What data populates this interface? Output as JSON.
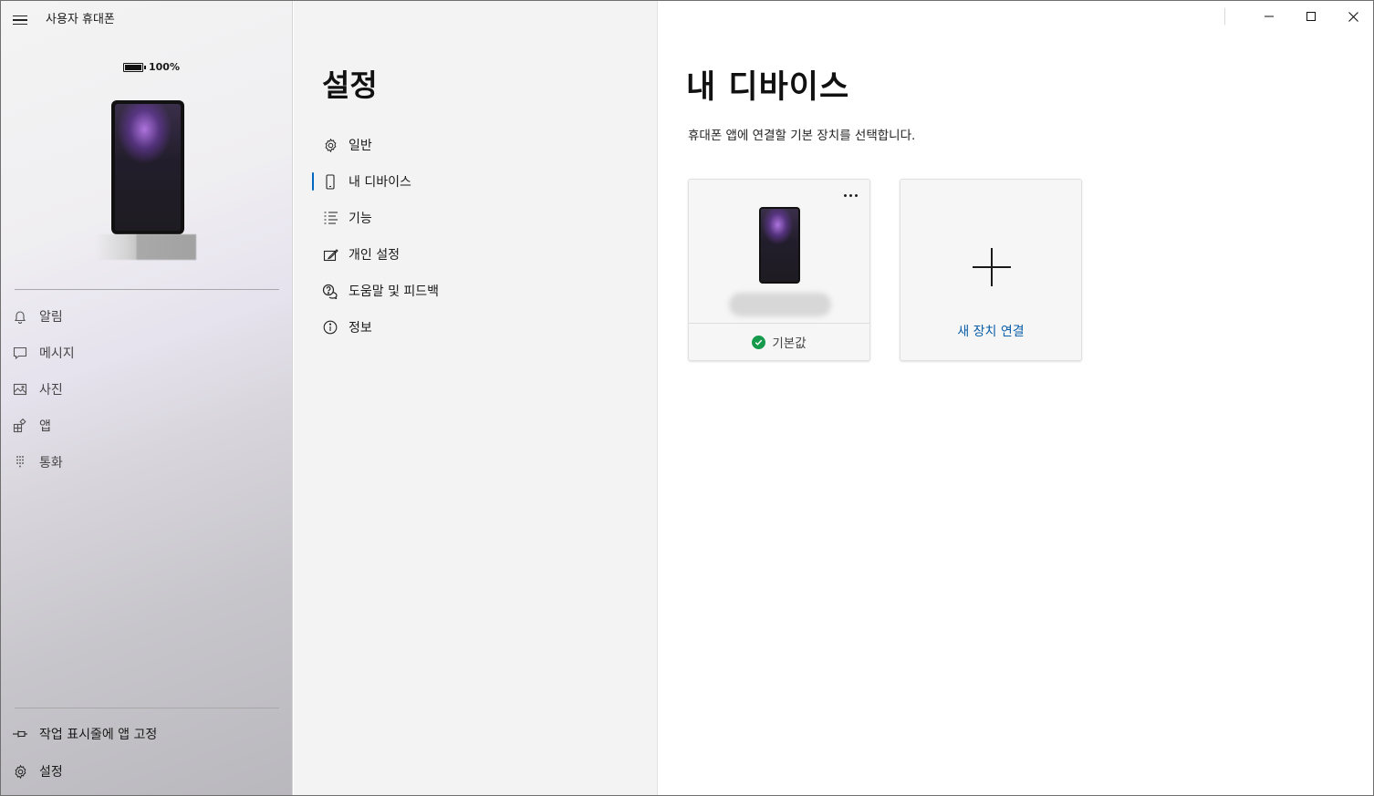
{
  "app": {
    "title": "사용자 휴대폰"
  },
  "phone": {
    "battery": "100%"
  },
  "sidebar": {
    "items": [
      {
        "label": "알림",
        "icon": "bell-icon"
      },
      {
        "label": "메시지",
        "icon": "message-icon"
      },
      {
        "label": "사진",
        "icon": "photo-icon"
      },
      {
        "label": "앱",
        "icon": "apps-icon"
      },
      {
        "label": "통화",
        "icon": "dialpad-icon"
      }
    ],
    "pin_label": "작업 표시줄에 앱 고정",
    "settings_label": "설정"
  },
  "settings": {
    "title": "설정",
    "items": [
      {
        "label": "일반",
        "icon": "gear-icon"
      },
      {
        "label": "내 디바이스",
        "icon": "phone-icon",
        "selected": true
      },
      {
        "label": "기능",
        "icon": "features-list-icon"
      },
      {
        "label": "개인 설정",
        "icon": "personalize-icon"
      },
      {
        "label": "도움말 및 피드백",
        "icon": "help-feedback-icon"
      },
      {
        "label": "정보",
        "icon": "info-icon"
      }
    ]
  },
  "content": {
    "title": "내 디바이스",
    "description": "휴대폰 앱에 연결할 기본 장치를 선택합니다.",
    "device_card": {
      "status": "기본값"
    },
    "add_card": {
      "label": "새 장치 연결"
    }
  },
  "colors": {
    "accent": "#0067c0",
    "link": "#0a5ea8",
    "success": "#169b4c"
  }
}
